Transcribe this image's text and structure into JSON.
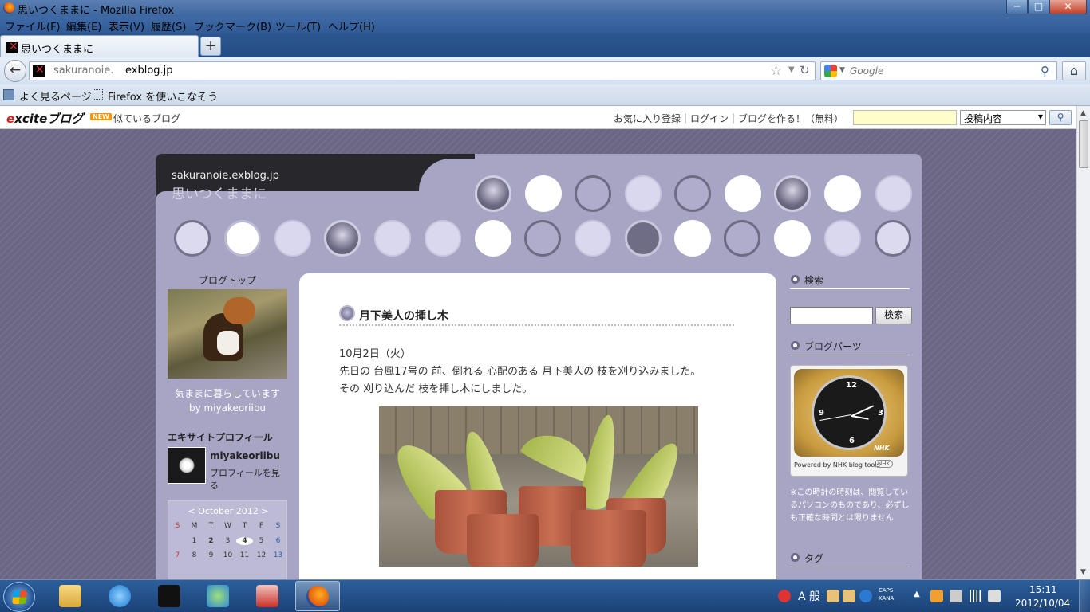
{
  "window": {
    "title": "思いつくままに - Mozilla Firefox",
    "controls": {
      "minimize": "─",
      "maximize": "□",
      "close": "✕"
    }
  },
  "menubar": [
    "ファイル(F)",
    "編集(E)",
    "表示(V)",
    "履歴(S)",
    "ブックマーク(B)",
    "ツール(T)",
    "ヘルプ(H)"
  ],
  "tabs": {
    "active_label": "思いつくままに",
    "new_tab": "+"
  },
  "navbar": {
    "back_glyph": "←",
    "url_prefix": "sakuranoie.",
    "url_domain": "exblog.jp",
    "star_glyph": "☆",
    "drop_glyph": "▼",
    "reload_glyph": "↻",
    "search_placeholder": "Google",
    "search_glyph": "⚲",
    "home_glyph": "⌂"
  },
  "bookmarks": [
    "よく見るページ",
    "Firefox を使いこなそう"
  ],
  "excite_bar": {
    "logo_e": "e",
    "logo_rest": "xciteブログ",
    "new_badge": "NEW",
    "similar": "似ているブログ",
    "links": "お気に入り登録｜ログイン｜ブログを作る！（無料）",
    "select_value": "投稿内容",
    "select_caret": "▼",
    "search_glyph": "⚲"
  },
  "blog": {
    "url": "sakuranoie.exblog.jp",
    "title": "思いつくままに",
    "left": {
      "blog_top": "ブログトップ",
      "desc_line1": "気ままに暮らしています",
      "desc_line2": "by miyakeoriibu",
      "profile_heading": "エキサイトプロフィール",
      "profile_name": "miyakeoriibu",
      "profile_link": "プロフィールを見る",
      "calendar": {
        "header": "< October 2012 >",
        "weekdays": [
          "S",
          "M",
          "T",
          "W",
          "T",
          "F",
          "S"
        ],
        "week1": [
          "",
          "1",
          "2",
          "3",
          "4",
          "5",
          "6"
        ],
        "week2": [
          "7",
          "8",
          "9",
          "10",
          "11",
          "12",
          "13"
        ]
      }
    },
    "post": {
      "title": "月下美人の挿し木",
      "date": "10月2日（火）",
      "line1": "先日の 台風17号の 前、倒れる 心配のある 月下美人の 枝を刈り込みました。",
      "line2": "その 刈り込んだ 枝を挿し木にしました。"
    },
    "right": {
      "search_heading": "検索",
      "search_button": "検索",
      "parts_heading": "ブログパーツ",
      "clock_brand": "NHK",
      "clock_powered": "Powered by NHK blog tools",
      "clock_numerals": [
        "12",
        "3",
        "6",
        "9"
      ],
      "clock_nhk_mark": "NHK",
      "clock_note": "※この時計の時刻は、閲覧しているパソコンのものであり、必ずしも正確な時間とは限りません",
      "tag_heading": "タグ"
    }
  },
  "taskbar": {
    "ime_label": "A 般",
    "caps": "CAPS",
    "kana": "KANA",
    "time": "15:11",
    "date": "2012/10/04"
  },
  "colors": {
    "titlebar": "#3d669f",
    "page_bg": "#6a6684",
    "blog_frame": "#a7a4c4",
    "excite_red": "#d9201f"
  },
  "icons": {
    "firefox": "firefox-logo-icon",
    "favicon": "exblog-favicon-icon",
    "star": "bookmark-star-icon",
    "reload": "reload-icon",
    "google": "google-search-engine-icon",
    "magnifier": "magnifier-icon",
    "home": "home-icon",
    "start": "windows-start-icon"
  }
}
